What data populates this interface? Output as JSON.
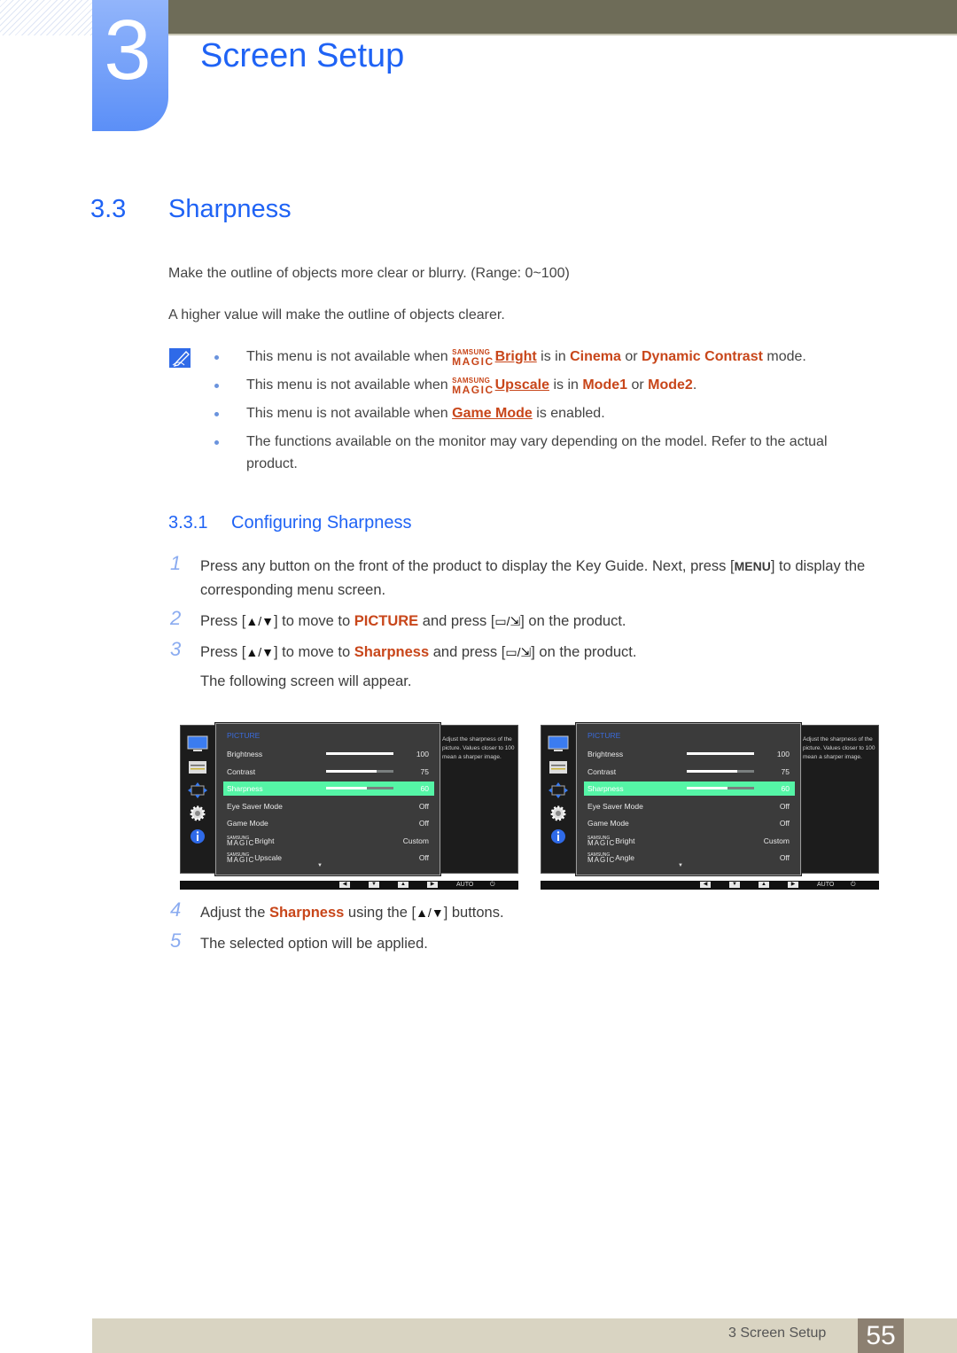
{
  "chapter": {
    "number": "3",
    "title": "Screen Setup"
  },
  "section": {
    "number": "3.3",
    "title": "Sharpness"
  },
  "intro": [
    "Make the outline of objects more clear or blurry. (Range: 0~100)",
    "A higher value will make the outline of objects clearer."
  ],
  "notes": {
    "icon": "note-pencil-icon",
    "magic_top": "SAMSUNG",
    "magic_bottom": "MAGIC",
    "items": [
      {
        "pre": "This menu is not available when ",
        "link": "Bright",
        "mid1": " is in ",
        "o1": "Cinema",
        "mid2": " or ",
        "o2": "Dynamic Contrast",
        "post": " mode."
      },
      {
        "pre": "This menu is not available when ",
        "link": "Upscale",
        "mid1": " is in ",
        "o1": "Mode1",
        "mid2": " or ",
        "o2": "Mode2",
        "post": "."
      },
      {
        "pre": "This menu is not available when ",
        "link": "Game Mode",
        "post": " is enabled."
      },
      {
        "text": "The functions available on the monitor may vary depending on the model. Refer to the actual product."
      }
    ]
  },
  "subsection": {
    "number": "3.3.1",
    "title": "Configuring Sharpness"
  },
  "steps": {
    "s1": {
      "n": "1",
      "a": "Press any button on the front of the product to display the Key Guide. Next, press [",
      "key": "MENU",
      "b": "] to display the corresponding menu screen."
    },
    "s2": {
      "n": "2",
      "a": "Press [",
      "arrows": "▲/▼",
      "b": "] to move to ",
      "target": "PICTURE",
      "c": " and press [",
      "enter": "▭/⇲",
      "d": "] on the product."
    },
    "s3": {
      "n": "3",
      "a": "Press [",
      "arrows": "▲/▼",
      "b": "] to move to ",
      "target": "Sharpness",
      "c": " and press [",
      "enter": "▭/⇲",
      "d": "] on the product."
    },
    "s3_after": "The following screen will appear.",
    "s4": {
      "n": "4",
      "a": "Adjust the ",
      "target": "Sharpness",
      "b": " using the [",
      "arrows": "▲/▼",
      "c": "] buttons."
    },
    "s5": {
      "n": "5",
      "text": "The selected option will be applied."
    }
  },
  "osd_screens": [
    {
      "menu_title": "PICTURE",
      "help": "Adjust the sharpness of the picture. Values closer to 100 mean a sharper image.",
      "rows": [
        {
          "label": "Brightness",
          "value": "100",
          "level": 100
        },
        {
          "label": "Contrast",
          "value": "75",
          "level": 75
        },
        {
          "label": "Sharpness",
          "value": "60",
          "level": 60,
          "selected": true
        },
        {
          "label": "Eye Saver Mode",
          "value": "Off"
        },
        {
          "label": "Game Mode",
          "value": "Off"
        },
        {
          "label": "Bright",
          "value": "Custom",
          "magic": true
        },
        {
          "label": "Upscale",
          "value": "Off",
          "magic": true
        }
      ],
      "keys": [
        "◀",
        "▼",
        "▲",
        "▶"
      ],
      "auto": "AUTO",
      "power": "⏻"
    },
    {
      "menu_title": "PICTURE",
      "help": "Adjust the sharpness of the picture. Values closer to 100 mean a sharper image.",
      "rows": [
        {
          "label": "Brightness",
          "value": "100",
          "level": 100
        },
        {
          "label": "Contrast",
          "value": "75",
          "level": 75
        },
        {
          "label": "Sharpness",
          "value": "60",
          "level": 60,
          "selected": true
        },
        {
          "label": "Eye Saver Mode",
          "value": "Off"
        },
        {
          "label": "Game Mode",
          "value": "Off"
        },
        {
          "label": "Bright",
          "value": "Custom",
          "magic": true
        },
        {
          "label": "Angle",
          "value": "Off",
          "magic": true
        }
      ],
      "keys": [
        "◀",
        "▼",
        "▲",
        "▶"
      ],
      "auto": "AUTO",
      "power": "⏻"
    }
  ],
  "footer": {
    "label": "3 Screen Setup",
    "page": "55"
  },
  "colors": {
    "accent_blue": "#1f63f5",
    "highlight_orange": "#c8461a",
    "osd_selection": "#55f5a6"
  }
}
